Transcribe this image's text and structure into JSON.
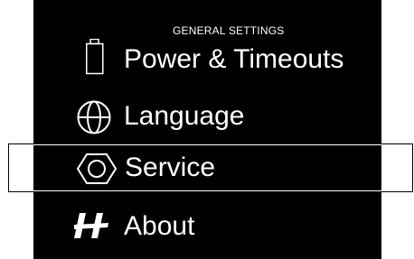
{
  "section_title": "GENERAL SETTINGS",
  "menu": {
    "items": [
      {
        "label": "Power & Timeouts",
        "icon": "battery-icon",
        "selected": false
      },
      {
        "label": "Language",
        "icon": "globe-icon",
        "selected": false
      },
      {
        "label": "Service",
        "icon": "hex-nut-icon",
        "selected": true
      },
      {
        "label": "About",
        "icon": "brand-h-logo-icon",
        "selected": false
      }
    ]
  },
  "colors": {
    "background": "#000000",
    "text": "#ffffff",
    "selection_border": "#ffffff"
  }
}
